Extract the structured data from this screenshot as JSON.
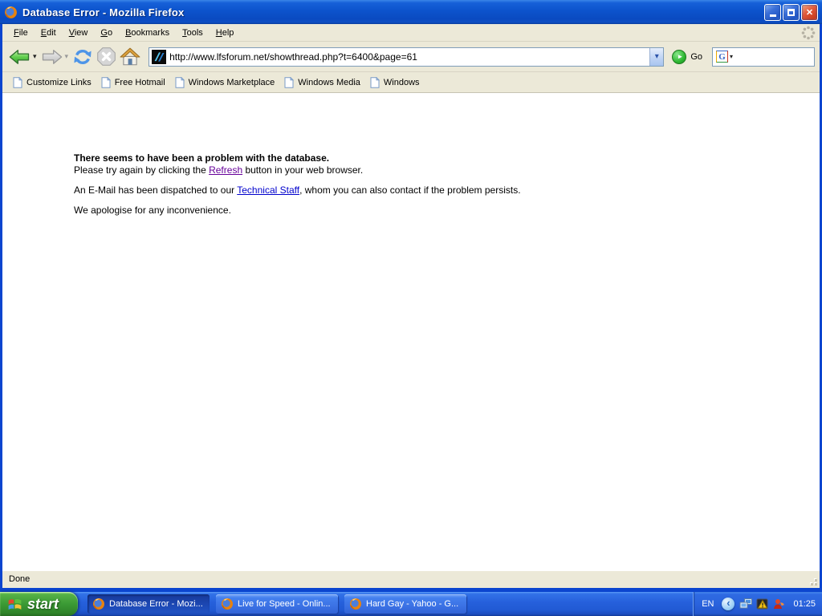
{
  "window": {
    "title": "Database Error - Mozilla Firefox"
  },
  "menu": {
    "items": [
      "File",
      "Edit",
      "View",
      "Go",
      "Bookmarks",
      "Tools",
      "Help"
    ]
  },
  "navbar": {
    "url": "http://www.lfsforum.net/showthread.php?t=6400&page=61",
    "go_label": "Go"
  },
  "search": {
    "logo_letter": "G",
    "value": ""
  },
  "bookmarks": {
    "items": [
      "Customize Links",
      "Free Hotmail",
      "Windows Marketplace",
      "Windows Media",
      "Windows"
    ]
  },
  "page": {
    "heading": "There seems to have been a problem with the database.",
    "line1_before": "Please try again by clicking the ",
    "refresh_link": "Refresh",
    "line1_after": " button in your web browser.",
    "line2_before": "An E-Mail has been dispatched to our ",
    "staff_link": "Technical Staff",
    "line2_after": ", whom you can also contact if the problem persists.",
    "line3": "We apologise for any inconvenience."
  },
  "statusbar": {
    "text": "Done"
  },
  "taskbar": {
    "start_label": "start",
    "tasks": [
      "Database Error - Mozi...",
      "Live for Speed - Onlin...",
      "Hard Gay - Yahoo - G..."
    ],
    "tray": {
      "language": "EN",
      "time": "01:25"
    }
  },
  "icons": {
    "caret_down": "▾",
    "chevron_left": "‹",
    "close_glyph": "✕",
    "go_arrow": "►"
  },
  "colors": {
    "titlebar_blue": "#0c53cc",
    "window_border": "#0b45cf",
    "toolbar_beige": "#ece9d8",
    "taskbar_blue": "#2660dc",
    "start_green": "#3b9a35",
    "close_red": "#e0583a",
    "link_blue": "#0000cc",
    "visited_link_purple": "#660099"
  }
}
